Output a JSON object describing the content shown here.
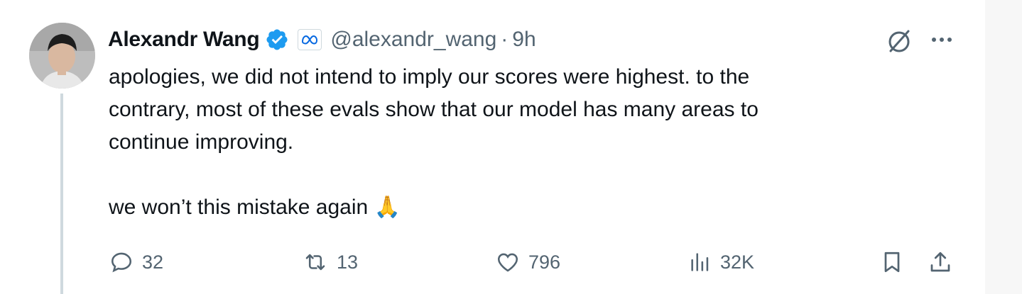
{
  "tweet": {
    "author_name": "Alexandr Wang",
    "handle": "@alexandr_wang",
    "separator": "·",
    "time": "9h",
    "text": "apologies, we did not intend to imply our scores were highest. to the\ncontrary, most of these evals show that our model has many areas to\ncontinue improving.\n\nwe won’t this mistake again 🙏"
  },
  "actions": {
    "replies": "32",
    "reposts": "13",
    "likes": "796",
    "views": "32K"
  },
  "icons": {
    "verified": "verified-badge-icon",
    "affiliation": "meta-logo-icon",
    "grok": "grok-icon",
    "more": "more-icon",
    "reply": "reply-icon",
    "repost": "repost-icon",
    "like": "heart-icon",
    "views": "views-icon",
    "bookmark": "bookmark-icon",
    "share": "share-icon"
  },
  "colors": {
    "text": "#0f1419",
    "secondary": "#536471",
    "verified_blue": "#1d9bf0",
    "meta_blue": "#0668e1"
  }
}
